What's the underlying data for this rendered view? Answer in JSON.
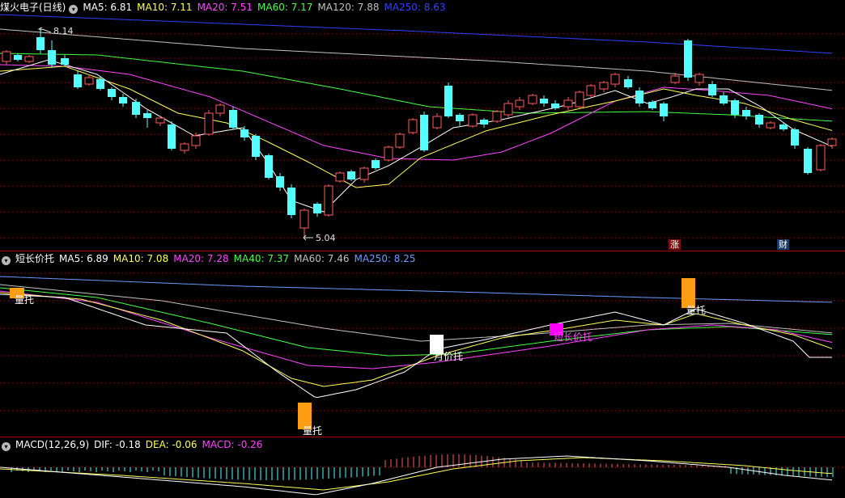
{
  "colors": {
    "background": "#000000",
    "grid": "#8a0000",
    "separator": "#b00000",
    "candle_up": "#ff5a5a",
    "candle_down": "#54ffff",
    "ma5": "#ffffff",
    "ma10": "#ffff55",
    "ma20": "#ff44ff",
    "ma40": "#44ff44",
    "ma60": "#44ff44",
    "ma120": "#c0c0c0",
    "ma250": "#3040ff",
    "mid_ma60": "#c0c0c0",
    "mid_ma250": "#6a9cff",
    "marker_orange": "#ff9e12",
    "marker_white": "#ffffff",
    "marker_magenta": "#ff00ff"
  },
  "main": {
    "title": "煤火电子(日线)",
    "toggle_icon": "circle-chevron-icon",
    "indicators": [
      {
        "label": "MA5: 6.81",
        "color": "#ffffff"
      },
      {
        "label": "MA10: 7.11",
        "color": "#ffff55"
      },
      {
        "label": "MA20: 7.51",
        "color": "#ff44ff"
      },
      {
        "label": "MA60: 7.17",
        "color": "#44ff44"
      },
      {
        "label": "MA120: 7.88",
        "color": "#c0c0c0"
      },
      {
        "label": "MA250: 8.63",
        "color": "#3040ff"
      }
    ],
    "high_label": "8.14",
    "low_label": "5.04",
    "event_tag_1": "涨",
    "event_tag_2": "财"
  },
  "mid": {
    "title": "短长价托",
    "indicators": [
      {
        "label": "MA5: 6.89",
        "color": "#ffffff"
      },
      {
        "label": "MA10: 7.08",
        "color": "#ffff55"
      },
      {
        "label": "MA20: 7.28",
        "color": "#ff44ff"
      },
      {
        "label": "MA40: 7.37",
        "color": "#44ff44"
      },
      {
        "label": "MA60: 7.46",
        "color": "#c0c0c0"
      },
      {
        "label": "MA250: 8.25",
        "color": "#6a9cff"
      }
    ],
    "signal_labels": [
      "量托",
      "量托",
      "月价托",
      "短长价托",
      "量托"
    ]
  },
  "macd": {
    "title": "MACD(12,26,9)",
    "indicators": [
      {
        "label": "DIF: -0.18",
        "color": "#ffffff"
      },
      {
        "label": "DEA: -0.06",
        "color": "#ffff55"
      },
      {
        "label": "MACD: -0.26",
        "color": "#ff44ff"
      }
    ]
  }
}
